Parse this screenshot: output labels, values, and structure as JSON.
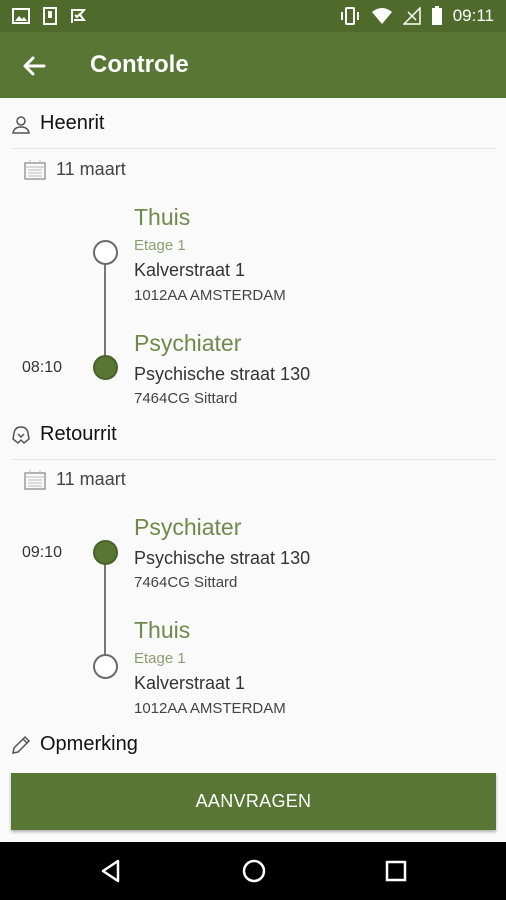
{
  "status_bar": {
    "time": "09:11",
    "left_icons": [
      "image-icon",
      "sim-icon",
      "check-flag-icon"
    ],
    "right_icons": [
      "vibrate-icon",
      "wifi-icon",
      "no-signal-icon",
      "battery-icon"
    ]
  },
  "app_bar": {
    "title": "Controle",
    "back_icon": "arrow-left-icon"
  },
  "outbound": {
    "heading": "Heenrit",
    "icon": "person-pin-icon",
    "date": "11 maart",
    "from": {
      "name": "Thuis",
      "floor": "Etage 1",
      "street": "Kalverstraat 1",
      "city": "1012AA AMSTERDAM"
    },
    "to": {
      "time": "08:10",
      "name": "Psychiater",
      "street": "Psychische straat 130",
      "city": "7464CG Sittard"
    }
  },
  "return": {
    "heading": "Retourrit",
    "icon": "return-icon",
    "date": "11 maart",
    "from": {
      "time": "09:10",
      "name": "Psychiater",
      "street": "Psychische straat 130",
      "city": "7464CG Sittard"
    },
    "to": {
      "name": "Thuis",
      "floor": "Etage 1",
      "street": "Kalverstraat 1",
      "city": "1012AA AMSTERDAM"
    }
  },
  "remark": {
    "heading": "Opmerking",
    "icon": "pencil-icon"
  },
  "request_button": "AANVRAGEN",
  "colors": {
    "primary": "#587634",
    "status_bar": "#4f6b2c",
    "accent_text": "#6f8a4c"
  }
}
